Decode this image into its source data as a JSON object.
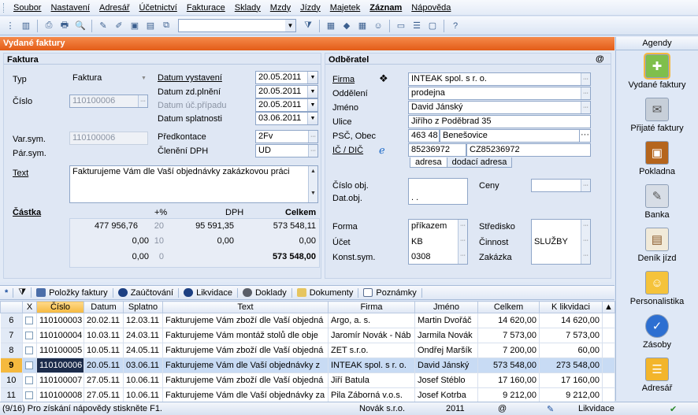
{
  "menu": [
    "Soubor",
    "Nastavení",
    "Adresář",
    "Účetnictví",
    "Fakturace",
    "Sklady",
    "Mzdy",
    "Jízdy",
    "Majetek",
    "Záznam",
    "Nápověda"
  ],
  "window_title": "Vydané faktury",
  "faktura": {
    "header": "Faktura",
    "typ_label": "Typ",
    "typ_value": "Faktura",
    "cislo_label": "Číslo",
    "cislo_value": "110100006",
    "varsym_label": "Var.sym.",
    "varsym_value": "110100006",
    "parsym_label": "Pár.sym.",
    "text_label": "Text",
    "text_value": "Fakturujeme Vám dle Vaší objednávky  zakázkovou práci",
    "datum_vystaveni_label": "Datum vystavení",
    "datum_vystaveni": "20.05.2011",
    "datum_zd_label": "Datum zd.plnění",
    "datum_zd": "20.05.2011",
    "datum_uc_label": "Datum úč.případu",
    "datum_uc": "20.05.2011",
    "datum_splatnosti_label": "Datum splatnosti",
    "datum_splatnosti": "03.06.2011",
    "predkontace_label": "Předkontace",
    "predkontace_value": "2Fv",
    "cleneni_label": "Členění DPH",
    "cleneni_value": "UD"
  },
  "castka": {
    "label": "Částka",
    "col_pct": "+%",
    "col_dph": "DPH",
    "col_celkem": "Celkem",
    "rows": [
      {
        "base": "477 956,76",
        "pct": "20",
        "dph": "95 591,35",
        "total": "573 548,11"
      },
      {
        "base": "0,00",
        "pct": "10",
        "dph": "0,00",
        "total": "0,00"
      },
      {
        "base": "0,00",
        "pct": "0",
        "dph": "",
        "total": "573 548,00"
      }
    ]
  },
  "odberatel": {
    "header": "Odběratel",
    "at_icon": "@",
    "firma_label": "Firma",
    "firma_value": "INTEAK spol. s r. o.",
    "oddeleni_label": "Oddělení",
    "oddeleni_value": "prodejna",
    "jmeno_label": "Jméno",
    "jmeno_value": "David Jánský",
    "ulice_label": "Ulice",
    "ulice_value": "Jiřího z Poděbrad 35",
    "psc_label": "PSČ, Obec",
    "psc_value": "463 48",
    "obec_value": "Benešovice",
    "ic_label": "IČ / DIČ",
    "ic_value": "85236972",
    "dic_value": "CZ85236972",
    "tab_adresa": "adresa",
    "tab_dodaci": "dodací adresa",
    "cislo_obj_label": "Číslo obj.",
    "dat_obj_label": "Dat.obj.",
    "dat_obj_value": ". .",
    "ceny_label": "Ceny",
    "forma_label": "Forma",
    "forma_value": "příkazem",
    "ucet_label": "Účet",
    "ucet_value": "KB",
    "konst_label": "Konst.sym.",
    "konst_value": "0308",
    "stredisko_label": "Středisko",
    "cinnost_label": "Činnost",
    "cinnost_value": "SLUŽBY",
    "zakazka_label": "Zakázka"
  },
  "grid_tabs": [
    "Položky faktury",
    "Zaúčtování",
    "Likvidace",
    "Doklady",
    "Dokumenty",
    "Poznámky"
  ],
  "grid": {
    "columns": [
      "X",
      "Číslo",
      "Datum",
      "Splatno",
      "Text",
      "Firma",
      "Jméno",
      "Celkem",
      "K likvidaci"
    ],
    "rows": [
      {
        "n": "6",
        "cislo": "110100003",
        "datum": "20.02.11",
        "splatno": "12.03.11",
        "text": "Fakturujeme Vám zboží dle Vaší objedná",
        "firma": "Argo, a. s.",
        "jmeno": "Martin Dvořáč",
        "celkem": "14 620,00",
        "klikv": "14 620,00"
      },
      {
        "n": "7",
        "cislo": "110100004",
        "datum": "10.03.11",
        "splatno": "24.03.11",
        "text": "Fakturujeme Vám montáž stolů dle obje",
        "firma": "Jaromír Novák - Náb",
        "jmeno": "Jarmila Novák",
        "celkem": "7 573,00",
        "klikv": "7 573,00"
      },
      {
        "n": "8",
        "cislo": "110100005",
        "datum": "10.05.11",
        "splatno": "24.05.11",
        "text": "Fakturujeme Vám zboží dle Vaší objedná",
        "firma": "ZET s.r.o.",
        "jmeno": "Ondřej Maršík",
        "celkem": "7 200,00",
        "klikv": "60,00"
      },
      {
        "n": "9",
        "cislo": "110100006",
        "datum": "20.05.11",
        "splatno": "03.06.11",
        "text": "Fakturujeme Vám dle Vaší objednávky z",
        "firma": "INTEAK spol. s r. o.",
        "jmeno": "David Jánský",
        "celkem": "573 548,00",
        "klikv": "273 548,00"
      },
      {
        "n": "10",
        "cislo": "110100007",
        "datum": "27.05.11",
        "splatno": "10.06.11",
        "text": "Fakturujeme Vám zboží dle Vaší objedná",
        "firma": "Jiří Batula",
        "jmeno": "Josef Stéblo",
        "celkem": "17 160,00",
        "klikv": "17 160,00"
      },
      {
        "n": "11",
        "cislo": "110100008",
        "datum": "27.05.11",
        "splatno": "10.06.11",
        "text": "Fakturujeme Vám dle Vaší objednávky za",
        "firma": "Pila Záborná v.o.s.",
        "jmeno": "Josef Kotrba",
        "celkem": "9 212,00",
        "klikv": "9 212,00"
      }
    ]
  },
  "status": {
    "help": "(9/16) Pro získání nápovědy stiskněte F1.",
    "company": "Novák s.r.o.",
    "year": "2011",
    "module": "Likvidace"
  },
  "agendy": {
    "title": "Agendy",
    "items": [
      "Vydané faktury",
      "Přijaté faktury",
      "Pokladna",
      "Banka",
      "Deník jízd",
      "Personalistika",
      "Zásoby",
      "Adresář"
    ]
  }
}
